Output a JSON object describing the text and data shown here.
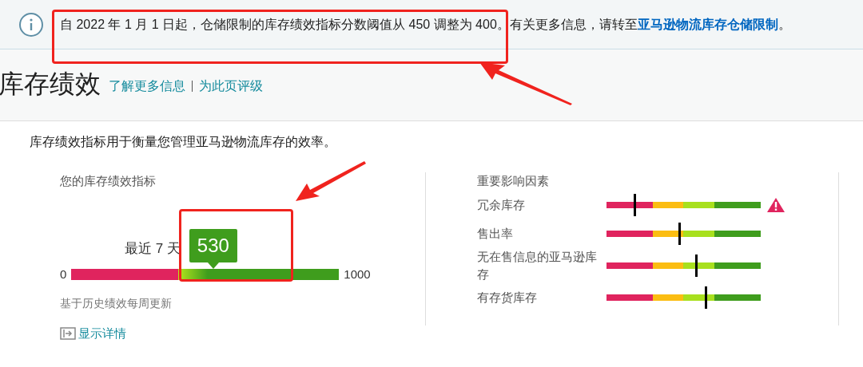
{
  "banner": {
    "message": "自 2022 年 1 月 1 日起，仓储限制的库存绩效指标分数阈值从 450 调整为 400。有关更多信息，请转至",
    "link": "亚马逊物流库存仓储限制",
    "end": "。"
  },
  "header": {
    "title": "库存绩效",
    "links": [
      "了解更多信息",
      "为此页评级"
    ]
  },
  "description": "库存绩效指标用于衡量您管理亚马逊物流库存的效率。",
  "score": {
    "heading": "您的库存绩效指标",
    "period": "最近 7 天",
    "value": "530",
    "min": "0",
    "max": "1000",
    "note": "基于历史绩效每周更新",
    "details_link": "显示详情"
  },
  "factors": {
    "heading": "重要影响因素",
    "items": [
      {
        "label": "冗余库存",
        "level": 0.18,
        "warning": true
      },
      {
        "label": "售出率",
        "level": 0.47,
        "warning": false
      },
      {
        "label": "无在售信息的亚马逊库存",
        "level": 0.58,
        "warning": false
      },
      {
        "label": "有存货库存",
        "level": 0.64,
        "warning": false
      }
    ]
  }
}
